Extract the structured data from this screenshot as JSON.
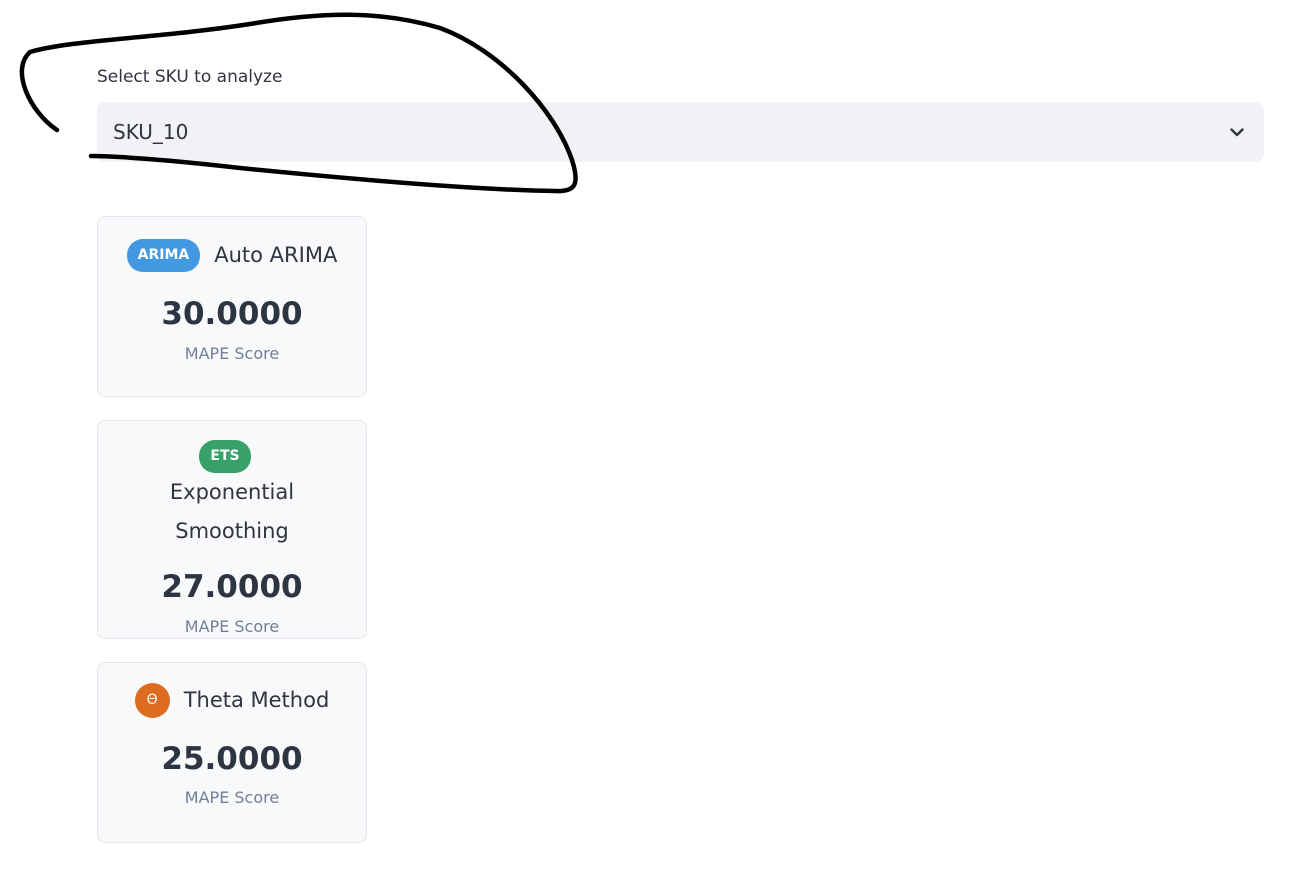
{
  "select": {
    "label": "Select SKU to analyze",
    "value": "SKU_10",
    "icon": "chevron-down-icon"
  },
  "colors": {
    "arima": "#4299e1",
    "ets": "#38a169",
    "theta": "#dd6b20",
    "annotation": "#000000"
  },
  "models": [
    {
      "badge": "ARIMA",
      "name": "Auto ARIMA",
      "score": "30.0000",
      "score_label": "MAPE Score"
    },
    {
      "badge": "ETS",
      "name": "Exponential Smoothing",
      "score": "27.0000",
      "score_label": "MAPE Score"
    },
    {
      "badge": "Θ",
      "name": "Theta Method",
      "score": "25.0000",
      "score_label": "MAPE Score"
    }
  ]
}
